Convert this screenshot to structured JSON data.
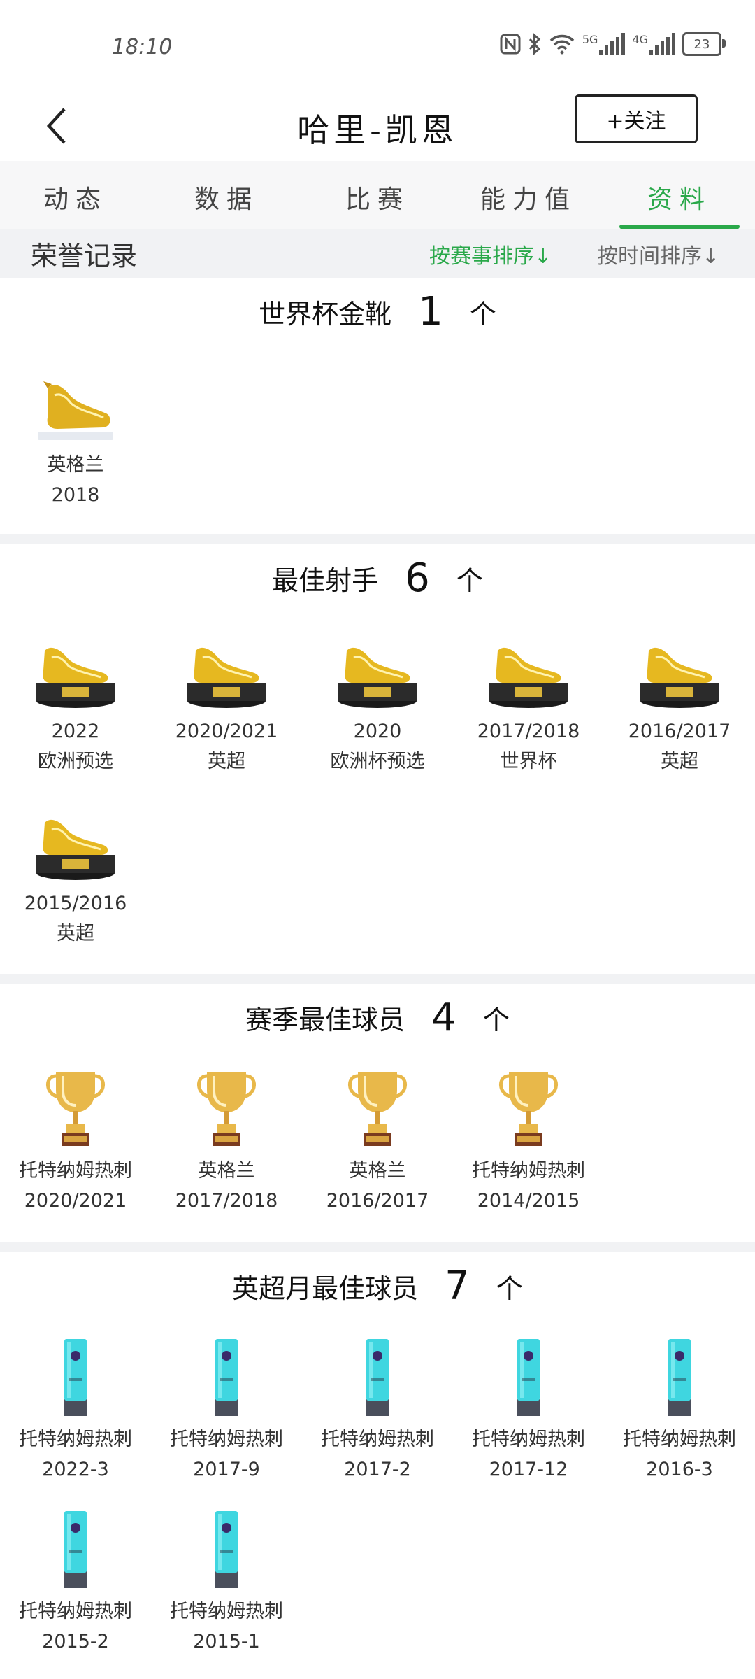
{
  "status_bar": {
    "time": "18:10",
    "battery": "23",
    "net1": "5G",
    "net2": "4G"
  },
  "header": {
    "title": "哈里-凯恩",
    "follow_label": "+关注"
  },
  "tabs": [
    "动态",
    "数据",
    "比赛",
    "能力值",
    "资料"
  ],
  "active_tab": "资料",
  "sort_bar": {
    "title": "荣誉记录",
    "by_event": "按赛事排序↓",
    "by_time": "按时间排序↓"
  },
  "sections": [
    {
      "name": "世界杯金靴",
      "count": "1",
      "unit": "个",
      "icon": "golden-boot-icon",
      "items": [
        {
          "line1": "英格兰",
          "line2": "2018"
        }
      ]
    },
    {
      "name": "最佳射手",
      "count": "6",
      "unit": "个",
      "icon": "golden-boot-trophy-icon",
      "items": [
        {
          "line1": "2022",
          "line2": "欧洲预选"
        },
        {
          "line1": "2020/2021",
          "line2": "英超"
        },
        {
          "line1": "2020",
          "line2": "欧洲杯预选"
        },
        {
          "line1": "2017/2018",
          "line2": "世界杯"
        },
        {
          "line1": "2016/2017",
          "line2": "英超"
        },
        {
          "line1": "2015/2016",
          "line2": "英超"
        }
      ]
    },
    {
      "name": "赛季最佳球员",
      "count": "4",
      "unit": "个",
      "icon": "cup-trophy-icon",
      "items": [
        {
          "line1": "托特纳姆热刺",
          "line2": "2020/2021"
        },
        {
          "line1": "英格兰",
          "line2": "2017/2018"
        },
        {
          "line1": "英格兰",
          "line2": "2016/2017"
        },
        {
          "line1": "托特纳姆热刺",
          "line2": "2014/2015"
        }
      ]
    },
    {
      "name": "英超月最佳球员",
      "count": "7",
      "unit": "个",
      "icon": "premier-league-award-icon",
      "items": [
        {
          "line1": "托特纳姆热刺",
          "line2": "2022-3"
        },
        {
          "line1": "托特纳姆热刺",
          "line2": "2017-9"
        },
        {
          "line1": "托特纳姆热刺",
          "line2": "2017-2"
        },
        {
          "line1": "托特纳姆热刺",
          "line2": "2017-12"
        },
        {
          "line1": "托特纳姆热刺",
          "line2": "2016-3"
        },
        {
          "line1": "托特纳姆热刺",
          "line2": "2015-2"
        },
        {
          "line1": "托特纳姆热刺",
          "line2": "2015-1"
        }
      ]
    }
  ],
  "colors": {
    "accent": "#2aa84a",
    "gold": "#e0b020",
    "divider": "#f1f2f4",
    "award_cyan": "#3fd6e0"
  }
}
